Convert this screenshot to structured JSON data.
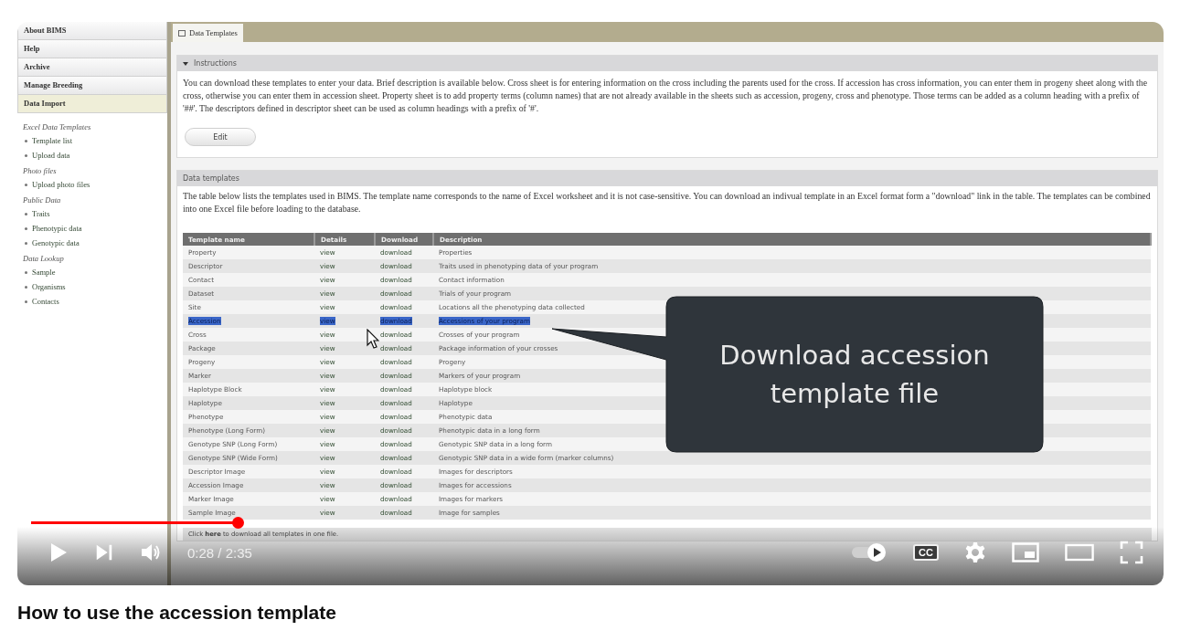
{
  "video": {
    "sidebar": {
      "menu": [
        {
          "label": "About BIMS",
          "selected": false
        },
        {
          "label": "Help",
          "selected": false
        },
        {
          "label": "Archive",
          "selected": false
        },
        {
          "label": "Manage Breeding",
          "selected": false
        },
        {
          "label": "Data Import",
          "selected": true
        }
      ],
      "sections": [
        {
          "heading": "Excel Data Templates",
          "links": [
            "Template list",
            "Upload data"
          ]
        },
        {
          "heading": "Photo files",
          "links": [
            "Upload photo files"
          ]
        },
        {
          "heading": "Public Data",
          "links": [
            "Traits",
            "Phenotypic data",
            "Genotypic data"
          ]
        },
        {
          "heading": "Data Lookup",
          "links": [
            "Sample",
            "Organisms",
            "Contacts"
          ]
        }
      ]
    },
    "tab": "Data Templates",
    "instructions": {
      "title": "Instructions",
      "text": "You can download these templates to enter your data. Brief description is available below. Cross sheet is for entering information on the cross including the parents used for the cross. If accession has cross information, you can enter them in progeny sheet along with the cross, otherwise you can enter them in accession sheet. Property sheet is to add property terms (column names) that are not already available in the sheets such as accession, progeny, cross and phenotype. Those terms can be added as a column heading with a prefix of '##'. The descriptors defined in descriptor sheet can be used as column headings with a prefix of '#'.",
      "button": "Edit"
    },
    "templates": {
      "title": "Data templates",
      "text": "The table below lists the templates used in BIMS. The template name corresponds to the name of Excel worksheet and it is not case-sensitive. You can download an indivual template in an Excel format form a \"download\" link in the table. The templates can be combined into one Excel file before loading to the database.",
      "columns": [
        "Template name",
        "Details",
        "Download",
        "Description"
      ],
      "rows": [
        {
          "name": "Property",
          "details": "view",
          "download": "download",
          "description": "Properties",
          "selected": false
        },
        {
          "name": "Descriptor",
          "details": "view",
          "download": "download",
          "description": "Traits used in phenotyping data of your program",
          "selected": false
        },
        {
          "name": "Contact",
          "details": "view",
          "download": "download",
          "description": "Contact information",
          "selected": false
        },
        {
          "name": "Dataset",
          "details": "view",
          "download": "download",
          "description": "Trials of your program",
          "selected": false
        },
        {
          "name": "Site",
          "details": "view",
          "download": "download",
          "description": "Locations all the phenotyping data collected",
          "selected": false
        },
        {
          "name": "Accession",
          "details": "view",
          "download": "download",
          "description": "Accessions of your program",
          "selected": true
        },
        {
          "name": "Cross",
          "details": "view",
          "download": "download",
          "description": "Crosses of your program",
          "selected": false
        },
        {
          "name": "Package",
          "details": "view",
          "download": "download",
          "description": "Package information of your crosses",
          "selected": false
        },
        {
          "name": "Progeny",
          "details": "view",
          "download": "download",
          "description": "Progeny",
          "selected": false
        },
        {
          "name": "Marker",
          "details": "view",
          "download": "download",
          "description": "Markers of your program",
          "selected": false
        },
        {
          "name": "Haplotype Block",
          "details": "view",
          "download": "download",
          "description": "Haplotype block",
          "selected": false
        },
        {
          "name": "Haplotype",
          "details": "view",
          "download": "download",
          "description": "Haplotype",
          "selected": false
        },
        {
          "name": "Phenotype",
          "details": "view",
          "download": "download",
          "description": "Phenotypic data",
          "selected": false
        },
        {
          "name": "Phenotype (Long Form)",
          "details": "view",
          "download": "download",
          "description": "Phenotypic data in a long form",
          "selected": false
        },
        {
          "name": "Genotype SNP (Long Form)",
          "details": "view",
          "download": "download",
          "description": "Genotypic SNP data in a long form",
          "selected": false
        },
        {
          "name": "Genotype SNP (Wide Form)",
          "details": "view",
          "download": "download",
          "description": "Genotypic SNP data in a wide form (marker columns)",
          "selected": false
        },
        {
          "name": "Descriptor Image",
          "details": "view",
          "download": "download",
          "description": "Images for descriptors",
          "selected": false
        },
        {
          "name": "Accession Image",
          "details": "view",
          "download": "download",
          "description": "Images for accessions",
          "selected": false
        },
        {
          "name": "Marker Image",
          "details": "view",
          "download": "download",
          "description": "Images for markers",
          "selected": false
        },
        {
          "name": "Sample Image",
          "details": "view",
          "download": "download",
          "description": "Image for samples",
          "selected": false
        }
      ],
      "footer": "Click **here** to download all templates in one file."
    },
    "callout": "Download accession template file",
    "player": {
      "level": 0.183,
      "time": "0:28 / 2:35",
      "autoplay_on": true,
      "cc_label": "CC"
    }
  },
  "title": "How to use the accession template"
}
